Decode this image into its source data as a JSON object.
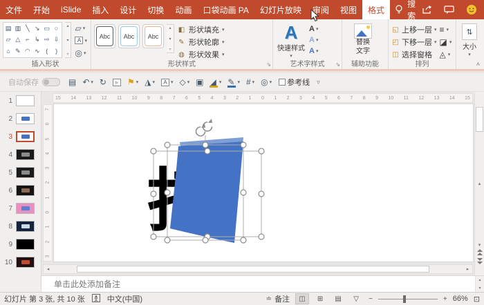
{
  "accent_color": "#C1492C",
  "shape_color": "#4472C4",
  "menu": {
    "tabs": [
      {
        "label": "文件"
      },
      {
        "label": "开始"
      },
      {
        "label": "iSlide"
      },
      {
        "label": "插入"
      },
      {
        "label": "设计"
      },
      {
        "label": "切换"
      },
      {
        "label": "动画"
      },
      {
        "label": "口袋动画 PA"
      },
      {
        "label": "幻灯片放映"
      },
      {
        "label": "审阅"
      },
      {
        "label": "视图"
      },
      {
        "label": "格式",
        "active": true
      }
    ],
    "search_label": "搜索"
  },
  "ribbon": {
    "insert_shapes": {
      "label": "插入形状",
      "gallery": [
        "▤",
        "▥",
        "╲",
        "↘",
        "▭",
        "○",
        "▱",
        "△",
        "⌐",
        "↳",
        "⇨",
        "⇩",
        "⌂",
        "✎",
        "◠",
        "∿",
        "(",
        ")"
      ],
      "side_buttons": [
        {
          "name": "edit-shape-button",
          "glyph": "▱"
        },
        {
          "name": "draw-textbox-button",
          "glyph": "A",
          "boxed": true
        },
        {
          "name": "merge-shapes-button",
          "glyph": "◎"
        }
      ]
    },
    "shape_styles": {
      "label": "形状样式",
      "chips": [
        {
          "label": "Abc",
          "border": "#5A5A5A"
        },
        {
          "label": "Abc",
          "border": "#9DC3E6"
        },
        {
          "label": "Abc",
          "border": "#F4B183"
        }
      ],
      "buttons": [
        {
          "icon": "◧",
          "label": "形状填充"
        },
        {
          "icon": "✎",
          "label": "形状轮廓"
        },
        {
          "icon": "◍",
          "label": "形状效果"
        }
      ]
    },
    "wordart": {
      "label": "艺术字样式",
      "big_a": "A",
      "quick_style": "快速样式",
      "side_icons": [
        {
          "name": "text-fill-button",
          "glyph": "A",
          "color": "#3b3b3b"
        },
        {
          "name": "text-outline-button",
          "glyph": "A",
          "color": "#8FAADC"
        },
        {
          "name": "text-effects-button",
          "glyph": "A",
          "color": "#4472C4"
        }
      ]
    },
    "accessibility": {
      "label": "辅助功能",
      "alt_line1": "替换",
      "alt_line2": "文字"
    },
    "arrange": {
      "label": "排列",
      "items": [
        {
          "icon": "◱",
          "label": "上移一层",
          "caret": true
        },
        {
          "icon": "◰",
          "label": "下移一层",
          "caret": true
        },
        {
          "icon": "◫",
          "label": "选择窗格",
          "caret": false
        }
      ],
      "icon_col": [
        {
          "name": "align-objects-button",
          "glyph": "≡"
        },
        {
          "name": "group-objects-button",
          "glyph": "◪"
        },
        {
          "name": "rotate-objects-button",
          "glyph": "◬"
        }
      ]
    },
    "size": {
      "label": "大小",
      "icon": "⇅"
    }
  },
  "qat": {
    "autosave_label": "自动保存",
    "guides_label": "参考线",
    "items": [
      {
        "name": "save-button",
        "glyph": "▤"
      },
      {
        "name": "undo-button",
        "glyph": "↶",
        "caret": true
      },
      {
        "name": "redo-button",
        "glyph": "↻"
      },
      {
        "name": "start-slideshow-button",
        "glyph": "▹",
        "boxed": true
      },
      {
        "name": "align-button",
        "glyph": "⚑",
        "color": "#D8A21A",
        "caret": true
      },
      {
        "name": "rotate-3d-button",
        "glyph": "◮",
        "caret": true
      },
      {
        "name": "textbox-button",
        "glyph": "A",
        "boxed": true,
        "caret": true
      },
      {
        "name": "shapes-button",
        "glyph": "◇",
        "caret": true
      },
      {
        "name": "selection-pane-button",
        "glyph": "▣"
      },
      {
        "name": "fill-color-button",
        "glyph": "◢",
        "underline": "#D8A21A",
        "caret": true
      },
      {
        "name": "outline-color-button",
        "glyph": "✎",
        "underline": "#2E74B5",
        "caret": true
      },
      {
        "name": "grid-button",
        "glyph": "#",
        "caret": true
      },
      {
        "name": "merge-shapes-qat-button",
        "glyph": "◎",
        "caret": true
      }
    ],
    "overflow_glyph": "▿"
  },
  "slides_panel": {
    "items": [
      {
        "num": "1",
        "bg": "#ffffff"
      },
      {
        "num": "2",
        "bg": "#ffffff",
        "mark": "#4472C4"
      },
      {
        "num": "3",
        "bg": "#ffffff",
        "mark": "#4472C4",
        "selected": true
      },
      {
        "num": "4",
        "bg": "#1a1a1a",
        "mark": "#8a8a8a"
      },
      {
        "num": "5",
        "bg": "#1a1a1a",
        "mark": "#8a8a8a"
      },
      {
        "num": "6",
        "bg": "#141414",
        "mark": "#8a6a52"
      },
      {
        "num": "7",
        "bg": "#E891C0",
        "mark": "#5B7FD4"
      },
      {
        "num": "8",
        "bg": "#16233C",
        "mark": "#CFD8EA"
      },
      {
        "num": "9",
        "bg": "#000000"
      },
      {
        "num": "10",
        "bg": "#201010",
        "mark": "#C04A2E"
      }
    ]
  },
  "ruler": {
    "h": [
      "15",
      "14",
      "13",
      "12",
      "11",
      "10",
      "9",
      "8",
      "7",
      "6",
      "5",
      "4",
      "3",
      "2",
      "1",
      "0",
      "1",
      "2",
      "3",
      "4",
      "5",
      "6",
      "7",
      "8",
      "9",
      "10",
      "11",
      "12",
      "13",
      "14",
      "15"
    ],
    "v": [
      "7",
      "6",
      "5",
      "4",
      "3",
      "2",
      "1",
      "0",
      "1",
      "2",
      "3"
    ]
  },
  "slide": {
    "glyph": "打"
  },
  "notes": {
    "placeholder": "单击此处添加备注"
  },
  "status": {
    "slide_info": "幻灯片 第 3 张, 共 10 张",
    "language": "中文(中国)",
    "notes_btn": "备注",
    "zoom_level": "66%",
    "views": [
      {
        "name": "normal-view-button",
        "glyph": "◫",
        "active": true
      },
      {
        "name": "slide-sorter-view-button",
        "glyph": "⊞"
      },
      {
        "name": "reading-view-button",
        "glyph": "▤"
      },
      {
        "name": "slideshow-view-button",
        "glyph": "▽"
      }
    ]
  }
}
